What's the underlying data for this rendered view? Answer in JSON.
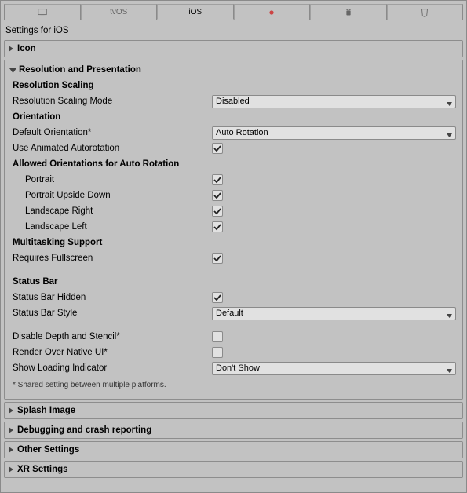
{
  "tabs": {
    "standalone": "",
    "tvos": "tvOS",
    "ios": "iOS",
    "lumin": "",
    "android": "",
    "webgl": ""
  },
  "title": "Settings for iOS",
  "foldouts": {
    "icon": "Icon",
    "splash": "Splash Image",
    "debugging": "Debugging and crash reporting",
    "other": "Other Settings",
    "xr": "XR Settings"
  },
  "resolution": {
    "heading": "Resolution and Presentation",
    "scaling_heading": "Resolution Scaling",
    "scaling_mode_label": "Resolution Scaling Mode",
    "scaling_mode_value": "Disabled",
    "orientation_heading": "Orientation",
    "default_orientation_label": "Default Orientation*",
    "default_orientation_value": "Auto Rotation",
    "use_animated_label": "Use Animated Autorotation",
    "use_animated_checked": true,
    "allowed_heading": "Allowed Orientations for Auto Rotation",
    "portrait_label": "Portrait",
    "portrait_checked": true,
    "portrait_upside_label": "Portrait Upside Down",
    "portrait_upside_checked": true,
    "landscape_right_label": "Landscape Right",
    "landscape_right_checked": true,
    "landscape_left_label": "Landscape Left",
    "landscape_left_checked": true,
    "multitasking_heading": "Multitasking Support",
    "requires_fullscreen_label": "Requires Fullscreen",
    "requires_fullscreen_checked": true,
    "status_bar_heading": "Status Bar",
    "status_bar_hidden_label": "Status Bar Hidden",
    "status_bar_hidden_checked": true,
    "status_bar_style_label": "Status Bar Style",
    "status_bar_style_value": "Default",
    "disable_depth_label": "Disable Depth and Stencil*",
    "disable_depth_checked": false,
    "render_native_label": "Render Over Native UI*",
    "render_native_checked": false,
    "loading_indicator_label": "Show Loading Indicator",
    "loading_indicator_value": "Don't Show",
    "footnote": "* Shared setting between multiple platforms."
  }
}
